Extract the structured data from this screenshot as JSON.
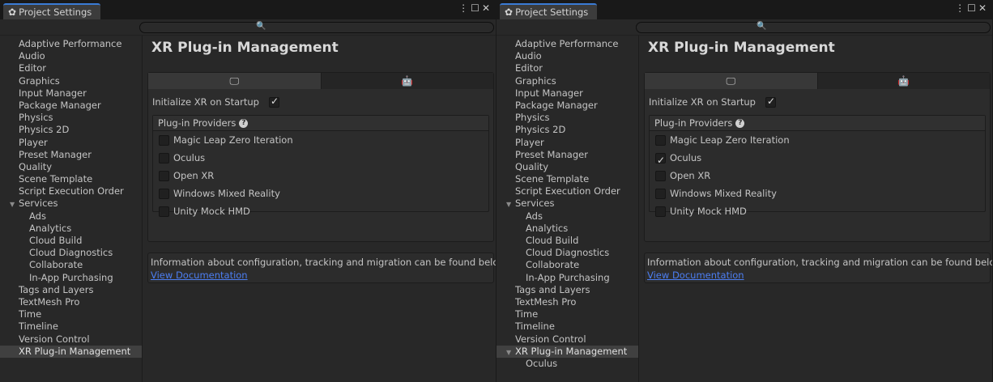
{
  "windows": {
    "left": {
      "tab_title": "Project Settings",
      "page_title": "XR Plug-in Management",
      "initialize_label": "Initialize XR on Startup",
      "initialize_checked": true,
      "providers_header": "Plug-in Providers",
      "providers": [
        {
          "label": "Magic Leap Zero Iteration",
          "checked": false
        },
        {
          "label": "Oculus",
          "checked": false
        },
        {
          "label": "Open XR",
          "checked": false
        },
        {
          "label": "Windows Mixed Reality",
          "checked": false
        },
        {
          "label": "Unity Mock HMD",
          "checked": false
        }
      ],
      "info_text": "Information about configuration, tracking and migration can be found below.",
      "doc_link": "View Documentation",
      "nav": [
        {
          "label": "Adaptive Performance"
        },
        {
          "label": "Audio"
        },
        {
          "label": "Editor"
        },
        {
          "label": "Graphics"
        },
        {
          "label": "Input Manager"
        },
        {
          "label": "Package Manager"
        },
        {
          "label": "Physics"
        },
        {
          "label": "Physics 2D"
        },
        {
          "label": "Player"
        },
        {
          "label": "Preset Manager"
        },
        {
          "label": "Quality"
        },
        {
          "label": "Scene Template"
        },
        {
          "label": "Script Execution Order"
        },
        {
          "label": "Services"
        },
        {
          "label": "Ads"
        },
        {
          "label": "Analytics"
        },
        {
          "label": "Cloud Build"
        },
        {
          "label": "Cloud Diagnostics"
        },
        {
          "label": "Collaborate"
        },
        {
          "label": "In-App Purchasing"
        },
        {
          "label": "Tags and Layers"
        },
        {
          "label": "TextMesh Pro"
        },
        {
          "label": "Time"
        },
        {
          "label": "Timeline"
        },
        {
          "label": "Version Control"
        },
        {
          "label": "XR Plug-in Management"
        }
      ]
    },
    "right": {
      "tab_title": "Project Settings",
      "page_title": "XR Plug-in Management",
      "initialize_label": "Initialize XR on Startup",
      "initialize_checked": true,
      "providers_header": "Plug-in Providers",
      "providers": [
        {
          "label": "Magic Leap Zero Iteration",
          "checked": false
        },
        {
          "label": "Oculus",
          "checked": true
        },
        {
          "label": "Open XR",
          "checked": false
        },
        {
          "label": "Windows Mixed Reality",
          "checked": false
        },
        {
          "label": "Unity Mock HMD",
          "checked": false
        }
      ],
      "info_text": "Information about configuration, tracking and migration can be found below.",
      "doc_link": "View Documentation",
      "nav": [
        {
          "label": "Adaptive Performance"
        },
        {
          "label": "Audio"
        },
        {
          "label": "Editor"
        },
        {
          "label": "Graphics"
        },
        {
          "label": "Input Manager"
        },
        {
          "label": "Package Manager"
        },
        {
          "label": "Physics"
        },
        {
          "label": "Physics 2D"
        },
        {
          "label": "Player"
        },
        {
          "label": "Preset Manager"
        },
        {
          "label": "Quality"
        },
        {
          "label": "Scene Template"
        },
        {
          "label": "Script Execution Order"
        },
        {
          "label": "Services"
        },
        {
          "label": "Ads"
        },
        {
          "label": "Analytics"
        },
        {
          "label": "Cloud Build"
        },
        {
          "label": "Cloud Diagnostics"
        },
        {
          "label": "Collaborate"
        },
        {
          "label": "In-App Purchasing"
        },
        {
          "label": "Tags and Layers"
        },
        {
          "label": "TextMesh Pro"
        },
        {
          "label": "Time"
        },
        {
          "label": "Timeline"
        },
        {
          "label": "Version Control"
        },
        {
          "label": "XR Plug-in Management"
        },
        {
          "label": "Oculus"
        }
      ]
    }
  },
  "icons": {
    "tab": "gear-icon",
    "search": "search-icon",
    "desktop_tab": "desktop-icon",
    "android_tab": "android-icon",
    "help": "help-icon"
  },
  "colors": {
    "accent": "#3a7bd5",
    "link": "#4c7ef2",
    "selected_row": "#404040"
  }
}
